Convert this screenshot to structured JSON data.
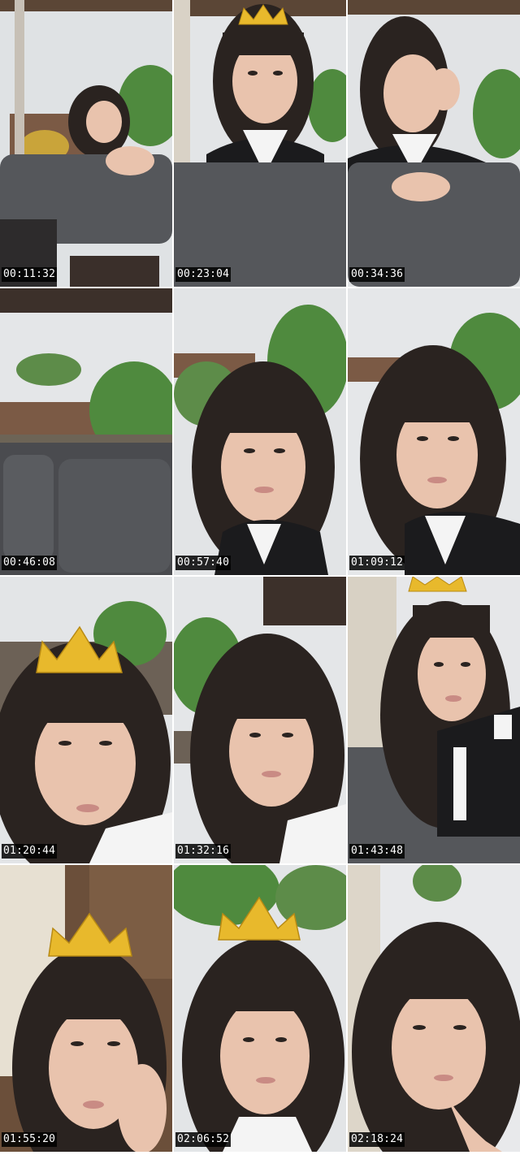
{
  "thumbnails": [
    {
      "timestamp": "00:11:32",
      "scene": "girl-with-pillow",
      "crown": false
    },
    {
      "timestamp": "00:23:04",
      "scene": "girl-portrait",
      "crown": true
    },
    {
      "timestamp": "00:34:36",
      "scene": "girl-hand-on-eye",
      "crown": false
    },
    {
      "timestamp": "00:46:08",
      "scene": "empty-sofa",
      "crown": false
    },
    {
      "timestamp": "00:57:40",
      "scene": "girl-closeup",
      "crown": false
    },
    {
      "timestamp": "01:09:12",
      "scene": "girl-closeup",
      "crown": false
    },
    {
      "timestamp": "01:20:44",
      "scene": "girl-closeup",
      "crown": true
    },
    {
      "timestamp": "01:32:16",
      "scene": "girl-closeup",
      "crown": false
    },
    {
      "timestamp": "01:43:48",
      "scene": "girl-sitting",
      "crown": true
    },
    {
      "timestamp": "01:55:20",
      "scene": "girl-hand-on-cheek",
      "crown": true
    },
    {
      "timestamp": "02:06:52",
      "scene": "girl-closeup",
      "crown": true
    },
    {
      "timestamp": "02:18:24",
      "scene": "girl-finger-on-lip",
      "crown": false
    }
  ],
  "colors": {
    "sky": "#e6e8ea",
    "palm": "#4f8a3e",
    "hair": "#2a2320",
    "skin": "#e9c3ad",
    "pillow": "#55575b",
    "crown": "#e8b92c",
    "shirt-black": "#1b1b1d",
    "shirt-white": "#f4f4f4",
    "timestamp-bg": "#000000"
  }
}
